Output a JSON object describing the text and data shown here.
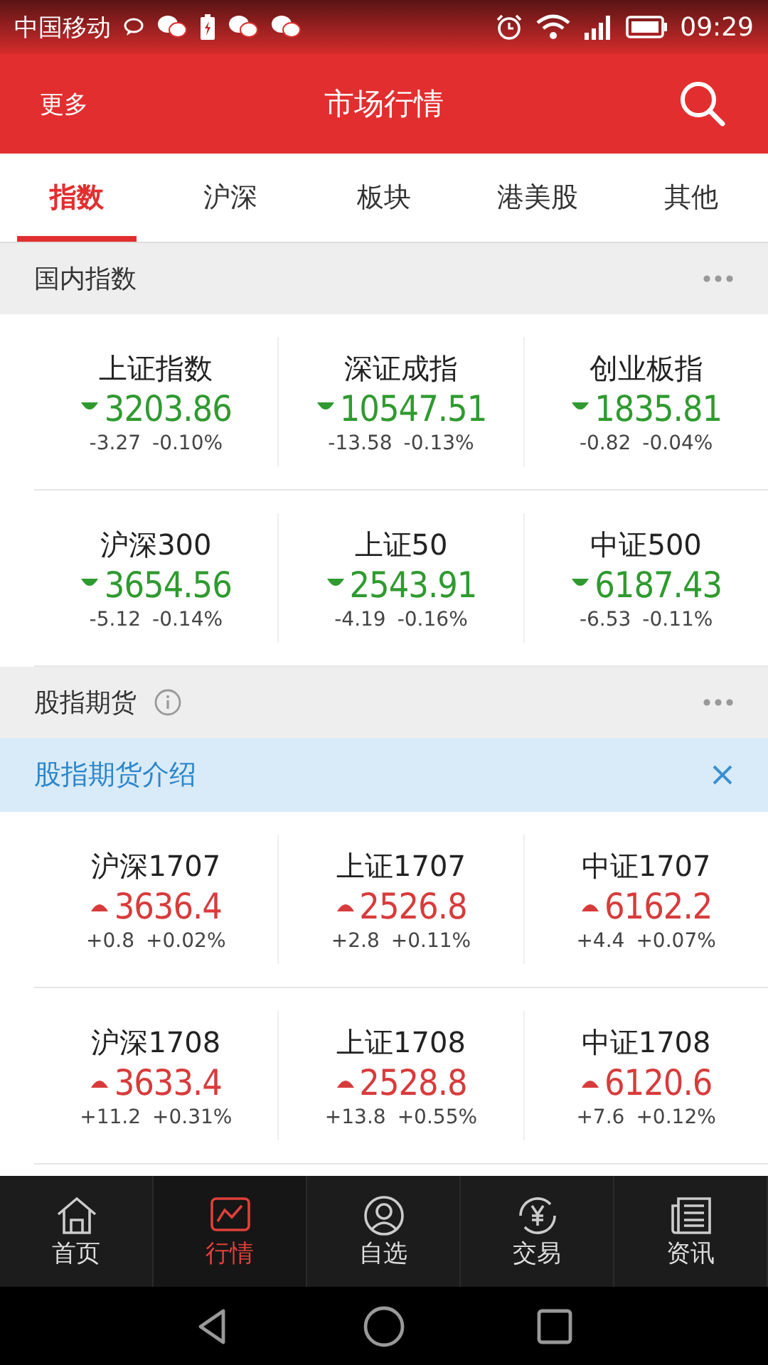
{
  "status_bar": {
    "carrier": "中国移动",
    "time": "09:29"
  },
  "header": {
    "left": "更多",
    "title": "市场行情"
  },
  "tabs": [
    {
      "label": "指数",
      "selected": true
    },
    {
      "label": "沪深",
      "selected": false
    },
    {
      "label": "板块",
      "selected": false
    },
    {
      "label": "港美股",
      "selected": false
    },
    {
      "label": "其他",
      "selected": false
    }
  ],
  "sections": [
    {
      "title": "国内指数",
      "info": false,
      "rows": [
        [
          {
            "name": "上证指数",
            "kind": "down",
            "value": "3203.86",
            "change": "-3.27",
            "pct": "-0.10%"
          },
          {
            "name": "深证成指",
            "kind": "down",
            "value": "10547.51",
            "change": "-13.58",
            "pct": "-0.13%"
          },
          {
            "name": "创业板指",
            "kind": "down",
            "value": "1835.81",
            "change": "-0.82",
            "pct": "-0.04%"
          }
        ],
        [
          {
            "name": "沪深300",
            "kind": "down",
            "value": "3654.56",
            "change": "-5.12",
            "pct": "-0.14%"
          },
          {
            "name": "上证50",
            "kind": "down",
            "value": "2543.91",
            "change": "-4.19",
            "pct": "-0.16%"
          },
          {
            "name": "中证500",
            "kind": "down",
            "value": "6187.43",
            "change": "-6.53",
            "pct": "-0.11%"
          }
        ]
      ]
    },
    {
      "title": "股指期货",
      "info": true,
      "banner": "股指期货介绍",
      "rows": [
        [
          {
            "name": "沪深1707",
            "kind": "up",
            "value": "3636.4",
            "change": "+0.8",
            "pct": "+0.02%"
          },
          {
            "name": "上证1707",
            "kind": "up",
            "value": "2526.8",
            "change": "+2.8",
            "pct": "+0.11%"
          },
          {
            "name": "中证1707",
            "kind": "up",
            "value": "6162.2",
            "change": "+4.4",
            "pct": "+0.07%"
          }
        ],
        [
          {
            "name": "沪深1708",
            "kind": "up",
            "value": "3633.4",
            "change": "+11.2",
            "pct": "+0.31%"
          },
          {
            "name": "上证1708",
            "kind": "up",
            "value": "2528.8",
            "change": "+13.8",
            "pct": "+0.55%"
          },
          {
            "name": "中证1708",
            "kind": "up",
            "value": "6120.6",
            "change": "+7.6",
            "pct": "+0.12%"
          }
        ]
      ]
    }
  ],
  "nav": [
    {
      "label": "首页",
      "kind": "home",
      "selected": false
    },
    {
      "label": "行情",
      "kind": "chart",
      "selected": true
    },
    {
      "label": "自选",
      "kind": "person",
      "selected": false
    },
    {
      "label": "交易",
      "kind": "trade",
      "selected": false
    },
    {
      "label": "资讯",
      "kind": "news",
      "selected": false
    }
  ]
}
